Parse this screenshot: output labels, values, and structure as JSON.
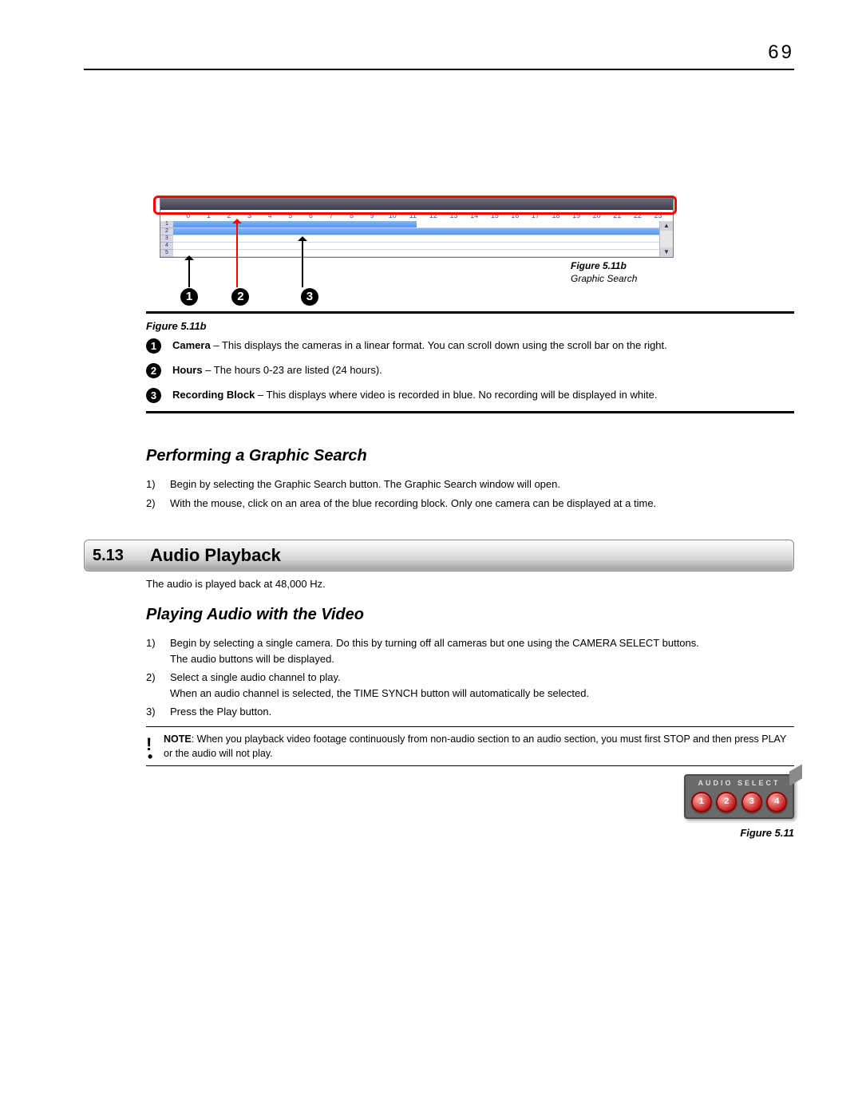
{
  "page_number": "69",
  "figure_511b": {
    "hours": [
      "0",
      "1",
      "2",
      "3",
      "4",
      "5",
      "6",
      "7",
      "8",
      "9",
      "10",
      "11",
      "12",
      "13",
      "14",
      "15",
      "16",
      "17",
      "18",
      "19",
      "20",
      "21",
      "22",
      "23"
    ],
    "cameras": [
      "1",
      "2",
      "3",
      "4",
      "5"
    ],
    "caption_label": "Figure 5.11b",
    "caption_text": "Graphic Search",
    "callouts": [
      "1",
      "2",
      "3"
    ]
  },
  "legend": {
    "title": "Figure 5.11b",
    "items": [
      {
        "num": "1",
        "term": "Camera",
        "desc": " – This displays the cameras in a linear format. You can scroll down using the scroll bar on the right."
      },
      {
        "num": "2",
        "term": "Hours",
        "desc": " – The hours 0-23 are listed (24 hours)."
      },
      {
        "num": "3",
        "term": "Recording Block",
        "desc": " – This displays where video is recorded in blue. No recording will be displayed in white."
      }
    ]
  },
  "subheading_graphic_search": "Performing a Graphic Search",
  "graphic_search_steps": [
    {
      "num": "1)",
      "text": "Begin by selecting the Graphic Search button. The Graphic Search window will open."
    },
    {
      "num": "2)",
      "text": "With the mouse, click on an area of the blue recording block. Only one camera can be displayed at a time."
    }
  ],
  "section": {
    "number": "5.13",
    "title": "Audio Playback"
  },
  "audio_intro": "The audio is played back at 48,000 Hz.",
  "subheading_playing_audio": "Playing Audio with the Video",
  "audio_steps": [
    {
      "num": "1)",
      "text": "Begin by selecting a single camera. Do this by turning off all cameras but one using the CAMERA SELECT buttons.\nThe audio buttons will be displayed."
    },
    {
      "num": "2)",
      "text": "Select a single audio channel to play.\nWhen an audio channel is selected, the TIME SYNCH button will automatically be selected."
    },
    {
      "num": "3)",
      "text": "Press the Play button."
    }
  ],
  "note": {
    "label": "NOTE",
    "text": ": When you playback video footage continuously from non-audio section to an audio section, you must first STOP and then press PLAY or the audio will not play."
  },
  "audio_select": {
    "title": "AUDIO SELECT",
    "buttons": [
      "1",
      "2",
      "3",
      "4"
    ],
    "caption": "Figure 5.11"
  }
}
